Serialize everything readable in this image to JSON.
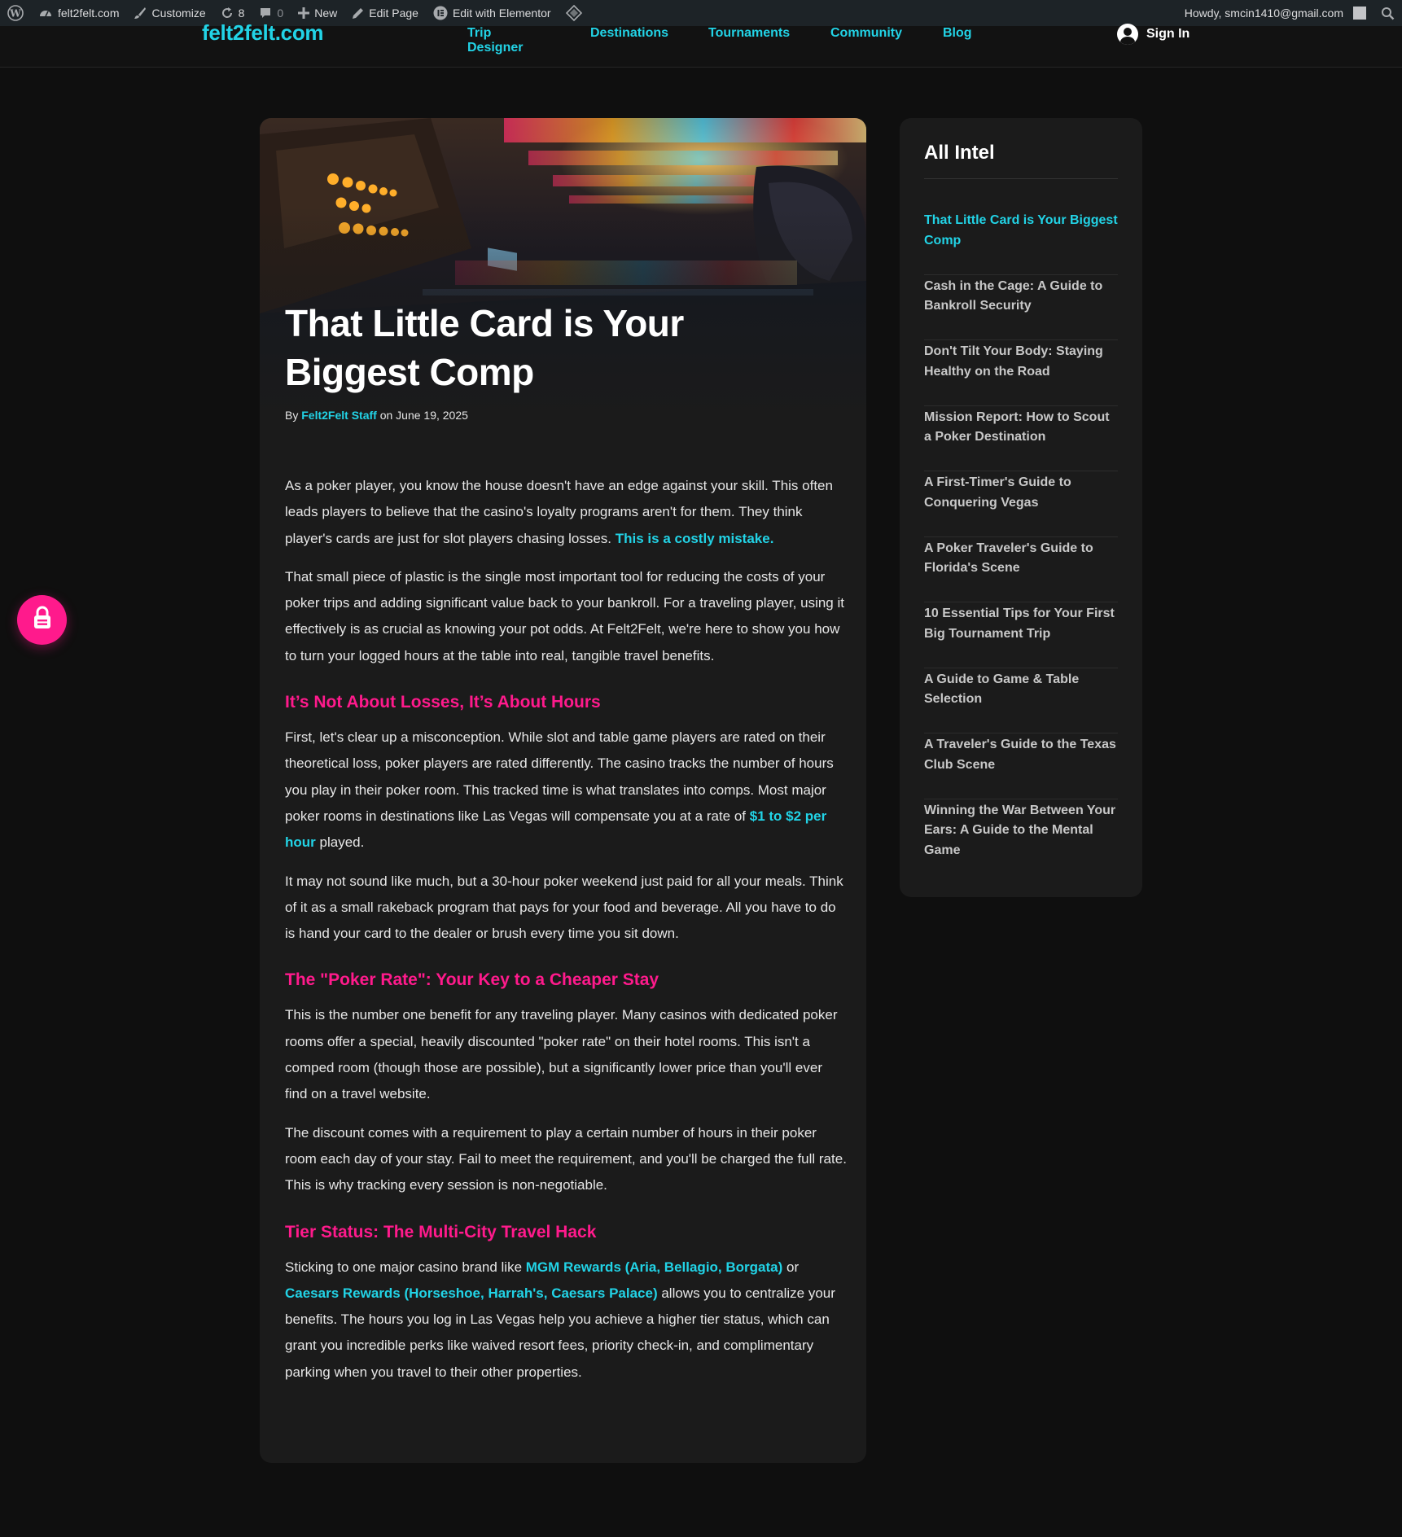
{
  "adminbar": {
    "site_name": "felt2felt.com",
    "customize": "Customize",
    "updates_count": "8",
    "comments_count": "0",
    "new_label": "New",
    "edit_page": "Edit Page",
    "elementor": "Edit with Elementor",
    "howdy": "Howdy, smcin1410@gmail.com"
  },
  "header": {
    "logo": "felt2felt.com",
    "nav": [
      "Trip Designer",
      "Destinations",
      "Tournaments",
      "Community",
      "Blog"
    ],
    "sign_in": "Sign In"
  },
  "article": {
    "title": "That Little Card is Your Biggest Comp",
    "by": "By",
    "author": "Felt2Felt Staff",
    "on": "on",
    "date": "June 19, 2025",
    "p1": {
      "text": "As a poker player, you know the house doesn't have an edge against your skill. This often leads players to believe that the casino's loyalty programs aren't for them. They think player's cards are just for slot players chasing losses. ",
      "highlight": "This is a costly mistake."
    },
    "p2": "That small piece of plastic is the single most important tool for reducing the costs of your poker trips and adding significant value back to your bankroll. For a traveling player, using it effectively is as crucial as knowing your pot odds. At Felt2Felt, we're here to show you how to turn your logged hours at the table into real, tangible travel benefits.",
    "h1": "It’s Not About Losses, It’s About Hours",
    "p3": {
      "text": "First, let's clear up a misconception. While slot and table game players are rated on their theoretical loss, poker players are rated differently. The casino tracks the number of hours you play in their poker room. This tracked time is what translates into comps. Most major poker rooms in destinations like Las Vegas will compensate you at a rate of ",
      "highlight": "$1 to $2 per hour",
      "after": " played."
    },
    "p4": "It may not sound like much, but a 30-hour poker weekend just paid for all your meals. Think of it as a small rakeback program that pays for your food and beverage. All you have to do is hand your card to the dealer or brush every time you sit down.",
    "h2": "The \"Poker Rate\": Your Key to a Cheaper Stay",
    "p5": "This is the number one benefit for any traveling player. Many casinos with dedicated poker rooms offer a special, heavily discounted \"poker rate\" on their hotel rooms. This isn't a comped room (though those are possible), but a significantly lower price than you'll ever find on a travel website.",
    "p6": "The discount comes with a requirement to play a certain number of hours in their poker room each day of your stay. Fail to meet the requirement, and you'll be charged the full rate. This is why tracking every session is non-negotiable.",
    "h3": "Tier Status: The Multi-City Travel Hack",
    "p7": {
      "before": "Sticking to one major casino brand like ",
      "hl1": "MGM Rewards (Aria, Bellagio, Borgata)",
      "mid": " or ",
      "hl2": "Caesars Rewards (Horseshoe, Harrah's, Caesars Palace)",
      "after": " allows you to centralize your benefits. The hours you log in Las Vegas help you achieve a higher tier status, which can grant you incredible perks like waived resort fees, priority check-in, and complimentary parking when you travel to their other properties."
    }
  },
  "sidebar": {
    "title": "All Intel",
    "items": [
      "That Little Card is Your Biggest Comp",
      "Cash in the Cage: A Guide to Bankroll Security",
      "Don't Tilt Your Body: Staying Healthy on the Road",
      "Mission Report: How to Scout a Poker Destination",
      "A First-Timer's Guide to Conquering Vegas",
      "A Poker Traveler's Guide to Florida's Scene",
      "10 Essential Tips for Your First Big Tournament Trip",
      "A Guide to Game & Table Selection",
      "A Traveler's Guide to the Texas Club Scene",
      "Winning the War Between Your Ears: A Guide to the Mental Game"
    ]
  },
  "colors": {
    "accent_cyan": "#22d3e6",
    "accent_pink": "#ff1a8c",
    "background": "#0f0f0f",
    "card": "#1b1b1b"
  },
  "icons": [
    "wordpress-icon",
    "dashboard-icon",
    "brush-icon",
    "refresh-icon",
    "comment-icon",
    "plus-icon",
    "pencil-icon",
    "elementor-icon",
    "diamond-icon",
    "search-icon",
    "user-icon",
    "lock-icon"
  ]
}
